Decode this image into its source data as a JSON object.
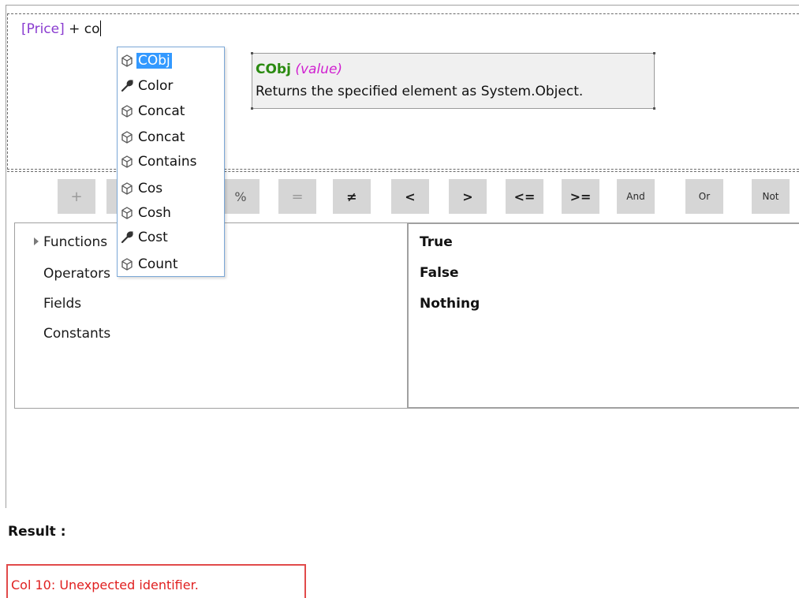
{
  "editor": {
    "field_token": "[Price]",
    "typed_text": " + co"
  },
  "toolbar": {
    "buttons": [
      "+",
      "%",
      "=",
      "≠",
      "<",
      ">",
      "<=",
      ">=",
      "And",
      "Or",
      "Not"
    ]
  },
  "categories": {
    "items": [
      "Functions",
      "Operators",
      "Fields",
      "Constants"
    ]
  },
  "constants": {
    "items": [
      "True",
      "False",
      "Nothing"
    ]
  },
  "autocomplete": {
    "items": [
      {
        "label": "CObj",
        "icon": "cube-icon",
        "selected": true
      },
      {
        "label": "Color",
        "icon": "wrench-icon"
      },
      {
        "label": "Concat",
        "icon": "cube-icon"
      },
      {
        "label": "Concat",
        "icon": "cube-icon"
      },
      {
        "label": "Contains",
        "icon": "cube-icon"
      },
      {
        "label": "Cos",
        "icon": "cube-icon"
      },
      {
        "label": "Cosh",
        "icon": "cube-icon"
      },
      {
        "label": "Cost",
        "icon": "wrench-icon"
      },
      {
        "label": "Count",
        "icon": "cube-icon"
      }
    ]
  },
  "tooltip": {
    "name": "CObj",
    "param": "(value)",
    "description": "Returns the specified element as System.Object."
  },
  "result": {
    "label": "Result :",
    "error": "Col 10: Unexpected identifier."
  },
  "colors": {
    "field_token": "#8a3cd0",
    "selection": "#3399ff",
    "tooltip_name": "#2a8a10",
    "tooltip_param": "#d020d0",
    "error": "#e02020"
  }
}
